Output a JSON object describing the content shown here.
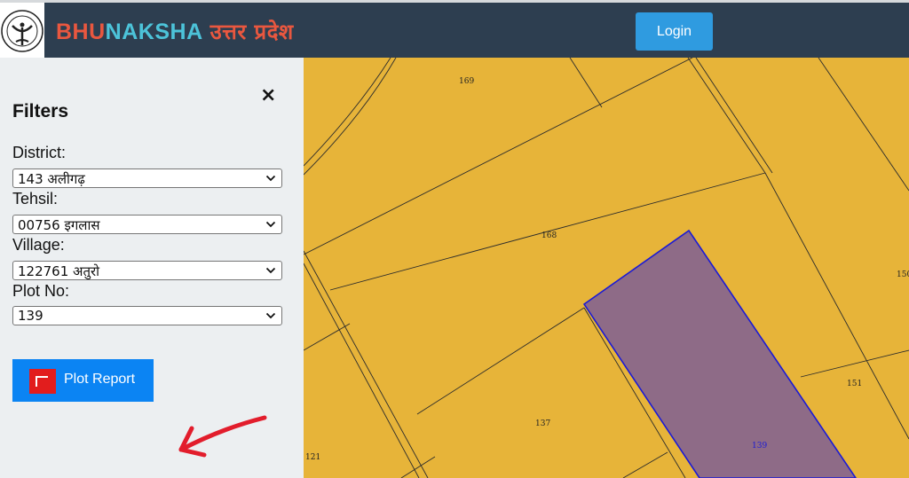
{
  "header": {
    "brand_part1": "BHU",
    "brand_part2": "NAKSHA",
    "brand_hindi": "उत्तर प्रदेश",
    "login_label": "Login"
  },
  "filters": {
    "title": "Filters",
    "close_symbol": "×",
    "district_label": "District:",
    "district_value": "143 अलीगढ़",
    "tehsil_label": "Tehsil:",
    "tehsil_value": "00756 इगलास",
    "village_label": "Village:",
    "village_value": "122761 अतुरो",
    "plotno_label": "Plot No:",
    "plotno_value": "139",
    "plot_report_label": "Plot Report"
  },
  "map": {
    "plots": [
      "169",
      "168",
      "150",
      "151",
      "137",
      "139",
      "121"
    ],
    "selected_plot": "139",
    "colors": {
      "parcel": "#e7b439",
      "selected": "#8e6b87",
      "selected_border": "#1a1ad6",
      "boundary": "#2b2b2b"
    }
  },
  "colors": {
    "header_bg": "#2d3e50",
    "login_bg": "#2f9be0",
    "plot_button_bg": "#0b84f3",
    "arrow": "#e21d2c"
  }
}
